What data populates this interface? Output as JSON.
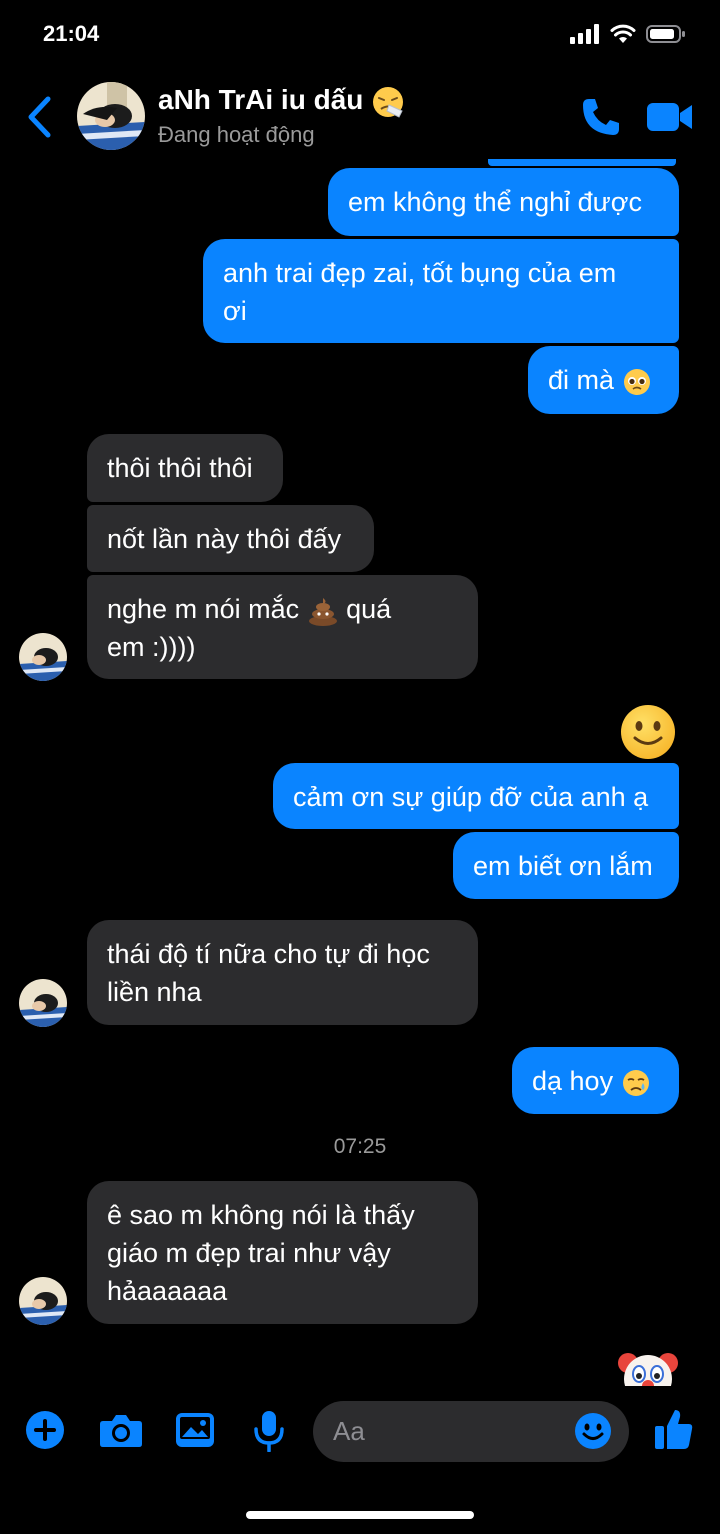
{
  "status_bar": {
    "time": "21:04"
  },
  "header": {
    "contact_name": "aNh TrAi iu dấu",
    "status": "Đang hoạt động"
  },
  "messages": [
    {
      "from": "me",
      "text": "em không thể nghỉ được"
    },
    {
      "from": "me",
      "line1": "anh trai đẹp zai, tốt bụng của em",
      "line2": "ơi"
    },
    {
      "from": "me",
      "text": "đi mà",
      "emoji": "pleading-face"
    },
    {
      "from": "them",
      "text": "thôi thôi thôi"
    },
    {
      "from": "them",
      "text": "nốt lần này thôi đấy"
    },
    {
      "from": "them",
      "line1a": "nghe m nói mắc",
      "emoji": "pile-of-poo",
      "line1b": "quá",
      "line2": "em :))))"
    },
    {
      "from": "me",
      "emoji_only": "slightly-smiling-face"
    },
    {
      "from": "me",
      "text": "cảm ơn sự giúp đỡ của anh ạ"
    },
    {
      "from": "me",
      "text": "em biết ơn lắm"
    },
    {
      "from": "them",
      "line1": "thái độ tí nữa cho tự đi học",
      "line2": "liền nha"
    },
    {
      "from": "me",
      "text": "dạ hoy",
      "emoji": "crying-face"
    },
    {
      "from": "them",
      "line1": "ê sao m không nói là thấy",
      "line2": "giáo m đẹp trai như vậy",
      "line3": "hảaaaaaa"
    },
    {
      "from": "me",
      "emoji_only": "clown-face"
    }
  ],
  "timestamp": "07:25",
  "composer": {
    "placeholder": "Aa"
  },
  "colors": {
    "sent_bubble": "#0a84ff",
    "received_bubble": "#2c2c2e",
    "accent": "#0a84ff"
  }
}
